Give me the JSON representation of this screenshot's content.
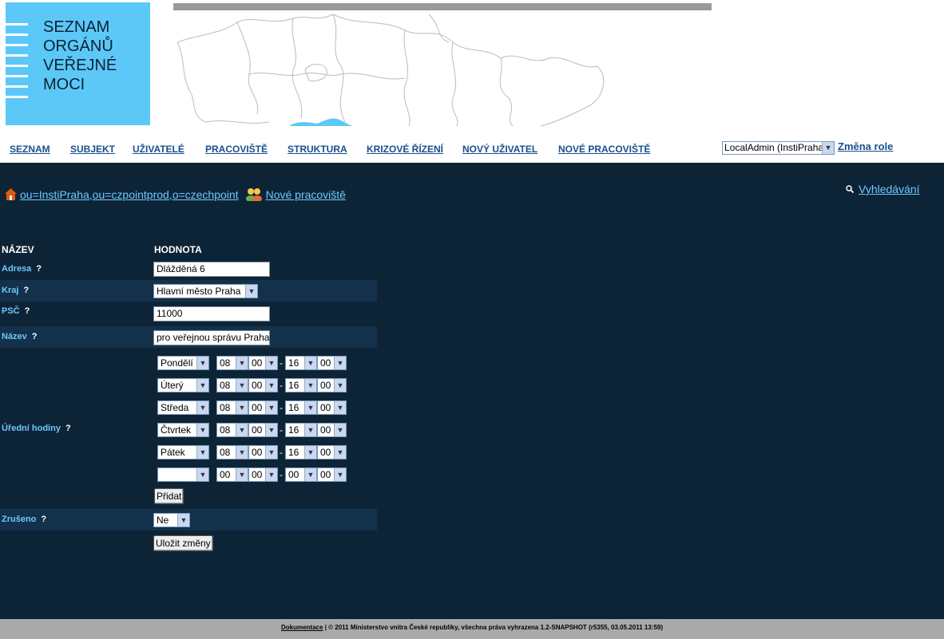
{
  "logo": {
    "lines": [
      "SEZNAM",
      "ORGÁNŮ",
      "VEŘEJNÉ",
      "MOCI"
    ]
  },
  "nav": {
    "items": [
      "SEZNAM",
      "SUBJEKT",
      "UŽIVATELÉ",
      "PRACOVIŠTĚ",
      "STRUKTURA",
      "KRIZOVÉ ŘÍZENÍ",
      "NOVÝ UŽIVATEL",
      "NOVÉ PRACOVIŠTĚ"
    ]
  },
  "role": {
    "selected": "LocalAdmin (InstiPraha)",
    "change_label": "Změna role"
  },
  "breadcrumb": {
    "path": "ou=InstiPraha,ou=czpointprod,o=czechpoint",
    "current": "Nové pracoviště"
  },
  "search": {
    "label": "Vyhledávání"
  },
  "table": {
    "col_name": "NÁZEV",
    "col_value": "HODNOTA",
    "fields": {
      "adresa": {
        "label": "Adresa",
        "help": "?",
        "value": "Dlážděná 6"
      },
      "kraj": {
        "label": "Kraj",
        "help": "?",
        "value": "Hlavní město Praha"
      },
      "psc": {
        "label": "PSČ",
        "help": "?",
        "value": "11000"
      },
      "nazev": {
        "label": "Název",
        "help": "?",
        "value": "pro veřejnou správu Praha"
      },
      "hodiny": {
        "label": "Úřední hodiny",
        "help": "?"
      },
      "zruseno": {
        "label": "Zrušeno",
        "help": "?",
        "value": "Ne"
      }
    },
    "hours": [
      {
        "day": "Pondělí",
        "from_h": "08",
        "from_m": "00",
        "to_h": "16",
        "to_m": "00"
      },
      {
        "day": "Úterý",
        "from_h": "08",
        "from_m": "00",
        "to_h": "16",
        "to_m": "00"
      },
      {
        "day": "Středa",
        "from_h": "08",
        "from_m": "00",
        "to_h": "16",
        "to_m": "00"
      },
      {
        "day": "Čtvrtek",
        "from_h": "08",
        "from_m": "00",
        "to_h": "16",
        "to_m": "00"
      },
      {
        "day": "Pátek",
        "from_h": "08",
        "from_m": "00",
        "to_h": "16",
        "to_m": "00"
      },
      {
        "day": "",
        "from_h": "00",
        "from_m": "00",
        "to_h": "00",
        "to_m": "00"
      }
    ],
    "hours_sep": "-",
    "add_label": "Přidat",
    "save_label": "Uložit změny"
  },
  "footer": {
    "doc_link": "Dokumentace",
    "text": "| © 2011 Ministerstvo vnitra České republiky, všechna práva vyhrazena 1.2-SNAPSHOT (r5355, 03.05.2011 13:59)"
  },
  "colors": {
    "bg_main": "#0d2437",
    "accent": "#6fc8ff",
    "logo_bg": "#5cc8f8",
    "nav_link": "#1a4f8c"
  }
}
